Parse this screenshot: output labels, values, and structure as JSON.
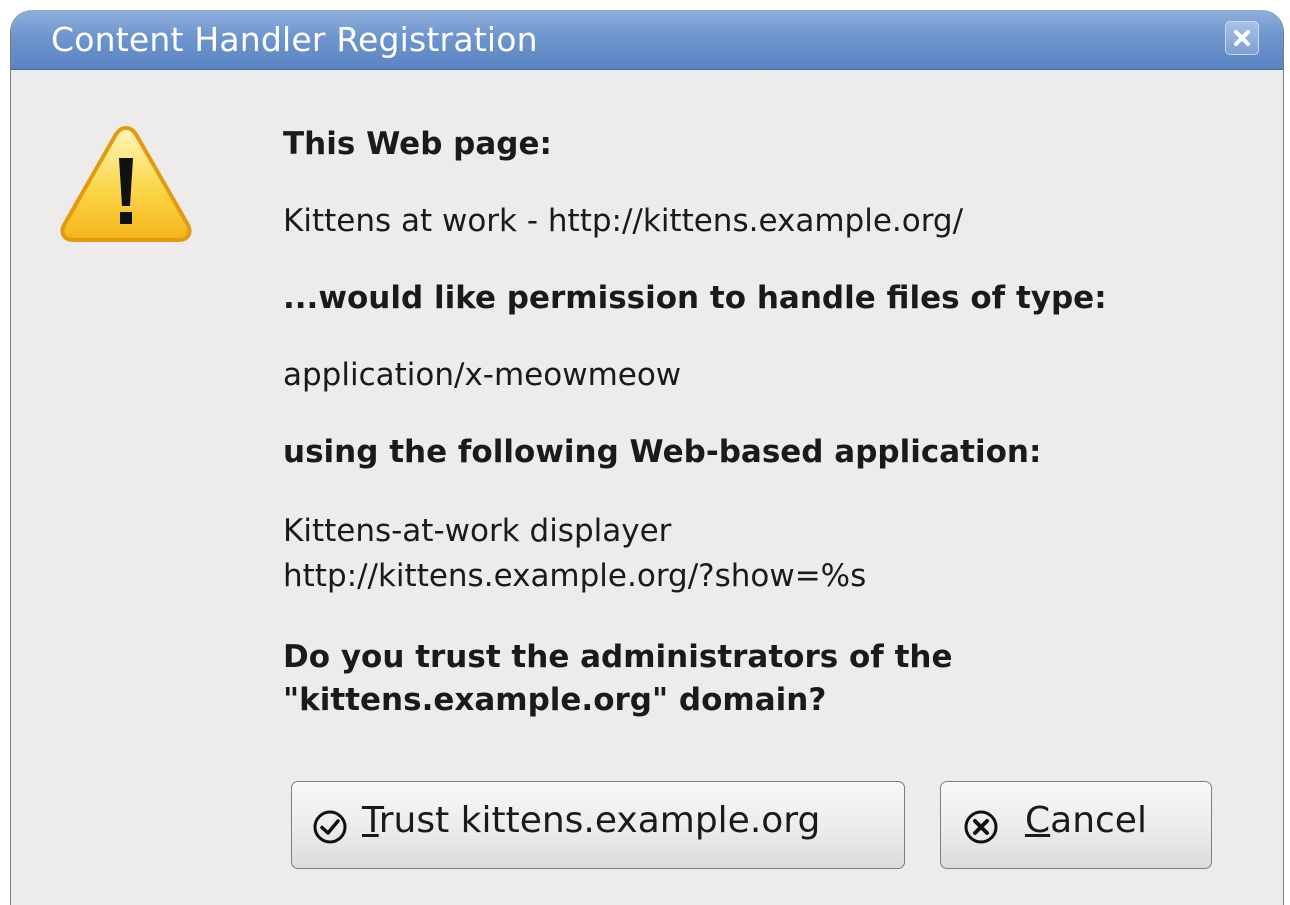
{
  "dialog": {
    "title": "Content Handler Registration",
    "close_icon": "close-icon",
    "warning_icon": "warning-icon"
  },
  "message": {
    "page_heading": "This Web page:",
    "page_value": "Kittens at work - http://kittens.example.org/",
    "type_heading": "...would like permission to handle files of type:",
    "type_value": "application/x-meowmeow",
    "app_heading": "using the following Web-based application:",
    "app_name": "Kittens-at-work displayer",
    "app_url": "http://kittens.example.org/?show=%s",
    "question_line1": "Do you trust the administrators of the",
    "question_line2": "\"kittens.example.org\" domain?"
  },
  "buttons": {
    "trust": {
      "mnemonic": "T",
      "rest": "rust kittens.example.org",
      "icon": "check-circle-icon"
    },
    "cancel": {
      "mnemonic": "C",
      "rest": "ancel",
      "icon": "x-circle-icon"
    }
  }
}
